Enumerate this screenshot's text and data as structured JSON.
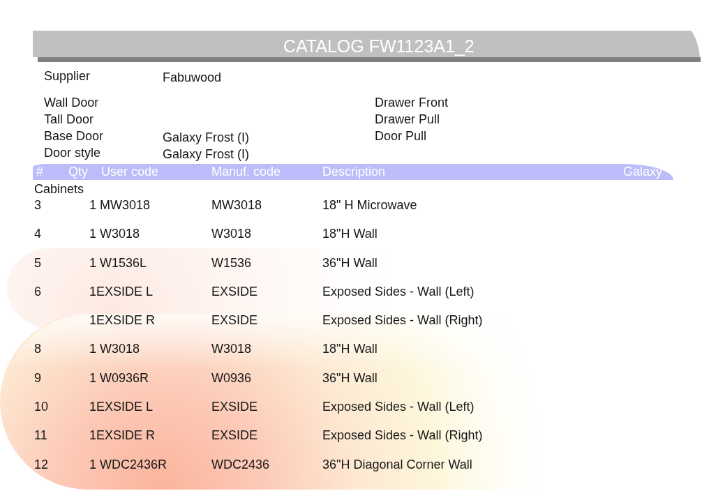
{
  "title": "CATALOG FW1123A1_2",
  "details": [
    {
      "label": "Supplier",
      "value": "Fabuwood"
    },
    {
      "label": "Wall Door",
      "right_label": "Drawer Front"
    },
    {
      "label": "Tall Door",
      "right_label": "Drawer Pull"
    },
    {
      "label": "Base Door",
      "value": "Galaxy Frost (I)",
      "right_label": "Door Pull"
    },
    {
      "label": "Door style",
      "value": "Galaxy Frost (I)"
    }
  ],
  "table": {
    "columns": [
      "#",
      "Qty",
      "User code",
      "Manuf. code",
      "Description",
      "Galaxy"
    ],
    "section": "Cabinets",
    "rows": [
      {
        "number": "3",
        "qty_user_code": "1 MW3018",
        "manuf_code": "MW3018",
        "description": "18\" H Microwave"
      },
      {
        "number": "4",
        "qty_user_code": "1 W3018",
        "manuf_code": "W3018",
        "description": "18\"H Wall"
      },
      {
        "number": "5",
        "qty_user_code": "1 W1536L",
        "manuf_code": "W1536",
        "description": "36\"H Wall"
      },
      {
        "number": "6",
        "qty_user_code": "1EXSIDE L",
        "manuf_code": "EXSIDE",
        "description": "Exposed Sides - Wall (Left)"
      },
      {
        "qty_user_code": "1EXSIDE R",
        "manuf_code": "EXSIDE",
        "description": "Exposed Sides - Wall (Right)"
      },
      {
        "number": "8",
        "qty_user_code": "1 W3018",
        "manuf_code": "W3018",
        "description": "18\"H Wall"
      },
      {
        "number": "9",
        "qty_user_code": "1 W0936R",
        "manuf_code": "W0936",
        "description": "36\"H Wall"
      },
      {
        "number": "10",
        "qty_user_code": "1EXSIDE L",
        "manuf_code": "EXSIDE",
        "description": "Exposed Sides - Wall (Left)"
      },
      {
        "number": "11",
        "qty_user_code": "1EXSIDE R",
        "manuf_code": "EXSIDE",
        "description": "Exposed Sides - Wall (Right)"
      },
      {
        "number": "12",
        "qty_user_code": "1 WDC2436R",
        "manuf_code": "WDC2436",
        "description": "36\"H Diagonal Corner Wall"
      }
    ]
  }
}
